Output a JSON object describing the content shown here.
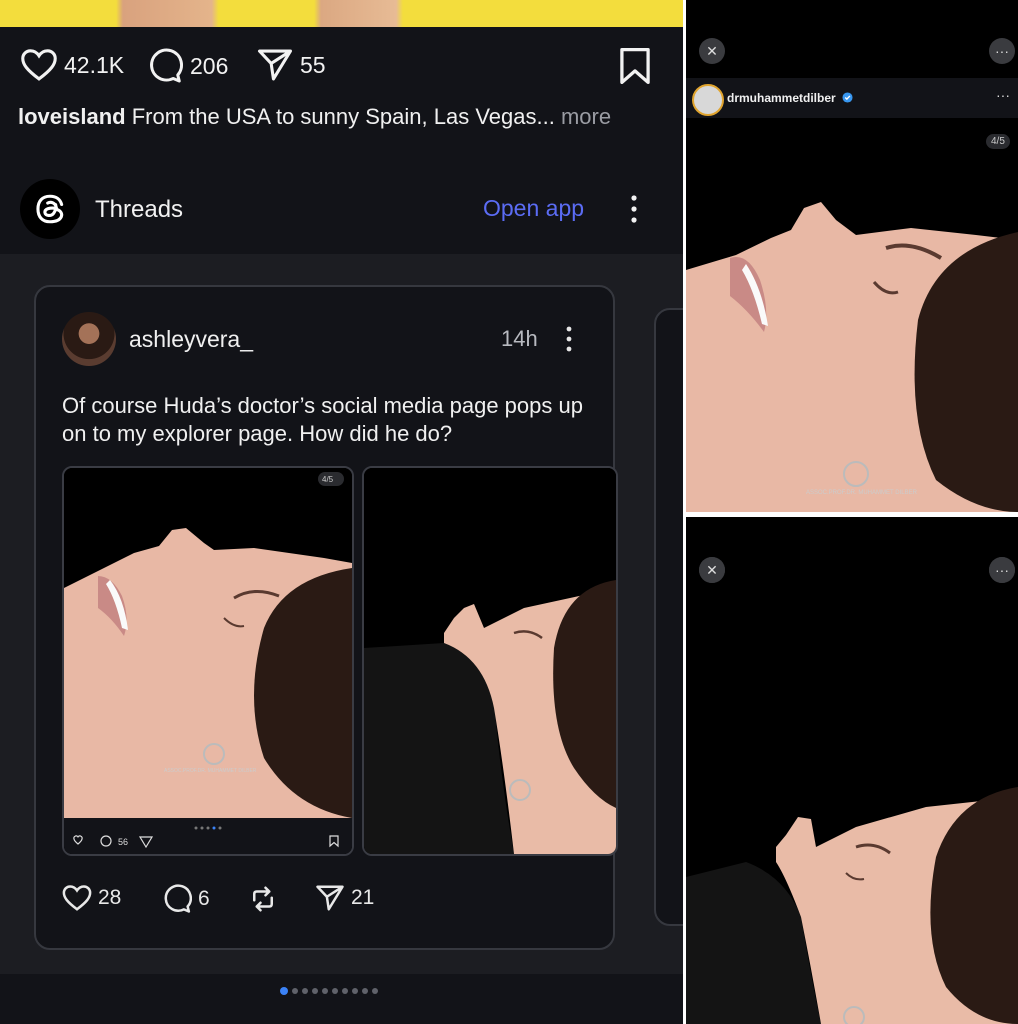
{
  "post": {
    "likes": "42.1K",
    "comments": "206",
    "shares": "55",
    "caption_user": "loveisland",
    "caption_text": " From the USA to sunny Spain, Las Vegas...",
    "caption_more": " more"
  },
  "threads_bar": {
    "title": "Threads",
    "open_app": "Open app"
  },
  "thread_post": {
    "username": "ashleyvera_",
    "time": "14h",
    "text": "Of course Huda’s doctor’s social media page pops up on to my explorer page. How did he do?",
    "likes": "28",
    "comments": "6",
    "shares": "21",
    "thumb1_counter": "4/5",
    "thumb1_comments": "56",
    "watermark": "ASSOC.PROF.DR. MUHAMMET DILBER"
  },
  "right_top": {
    "account": "drmuhammetdilber",
    "counter": "4/5",
    "watermark": "ASSOC.PROF.DR. MUHAMMET DILBER"
  },
  "colors": {
    "background": "#121318",
    "accent": "#5b6cf4",
    "verified": "#3897f0",
    "pager_active": "#3b82f6"
  }
}
